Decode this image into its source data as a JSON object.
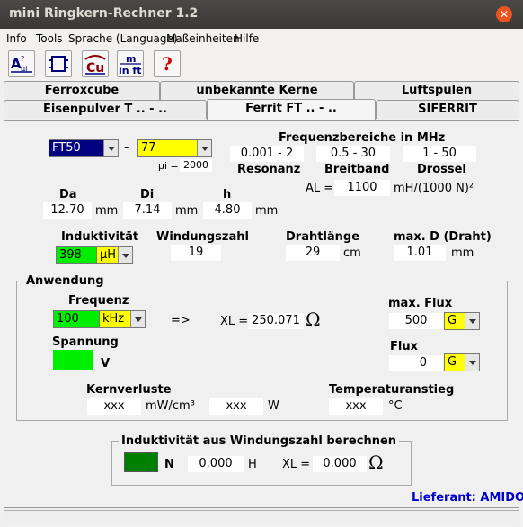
{
  "window": {
    "title": "mini Ringkern-Rechner 1.2"
  },
  "menu": [
    "Info",
    "Tools",
    "Sprache (Language)",
    "Maßeinheiten",
    "Hilfe"
  ],
  "toolbar": [
    {
      "icon": "inductance-ring-icon",
      "text": "A",
      "sub": "L μi"
    },
    {
      "icon": "coil-icon",
      "text": ""
    },
    {
      "icon": "copper-icon",
      "text": "Cu"
    },
    {
      "icon": "units-icon",
      "text": "m",
      "sub": "in ft"
    },
    {
      "icon": "help-icon",
      "text": "?"
    }
  ],
  "tabs_row1": [
    "Ferroxcube",
    "unbekannte Kerne",
    "Luftspulen"
  ],
  "tabs_row2": [
    "Eisenpulver T .. - ..",
    "Ferrit FT .. - ..",
    "SIFERRIT"
  ],
  "core": {
    "type": "FT50",
    "material": "77",
    "mui_label": "μi =",
    "mui": "2000"
  },
  "freq": {
    "title": "Frequenzbereiche in MHz",
    "resonanz": "0.001 - 2",
    "breitband": "0.5 - 30",
    "drossel": "1 - 50",
    "resonanz_label": "Resonanz",
    "breitband_label": "Breitband",
    "drossel_label": "Drossel",
    "al_label": "AL =",
    "al_value": "1100",
    "al_unit": "mH/(1000 N)²"
  },
  "dims": {
    "da_label": "Da",
    "da": "12.70",
    "di_label": "Di",
    "di": "7.14",
    "h_label": "h",
    "h": "4.80",
    "unit": "mm"
  },
  "calc": {
    "ind_label": "Induktivität",
    "ind_value": "398",
    "ind_unit": "μH",
    "turns_label": "Windungszahl",
    "turns": "19",
    "wire_label": "Drahtlänge",
    "wire": "29",
    "wire_unit": "cm",
    "maxd_label": "max. D (Draht)",
    "maxd": "1.01",
    "maxd_unit": "mm"
  },
  "anwendung": {
    "legend": "Anwendung",
    "freq_label": "Frequenz",
    "freq_value": "100",
    "freq_unit": "kHz",
    "arrow": "=>",
    "xl_label": "XL =",
    "xl_value": "250.071",
    "ohm": "Ω",
    "maxflux_label": "max. Flux",
    "maxflux_value": "500",
    "maxflux_unit": "G",
    "spannung_label": "Spannung",
    "spannung_value": "",
    "v_unit": "V",
    "flux_label": "Flux",
    "flux_value": "0",
    "flux_unit": "G",
    "kernverluste_label": "Kernverluste",
    "kv_value": "xxx",
    "kv_unit": "mW/cm³",
    "w_value": "xxx",
    "w_unit": "W",
    "temp_label": "Temperaturanstieg",
    "temp_value": "xxx",
    "temp_unit": "°C"
  },
  "windung": {
    "legend": "Induktivität aus Windungszahl berechnen",
    "n_value": "",
    "n_label": "N",
    "h_value": "0.000",
    "h_label": "H",
    "xl_label": "XL =",
    "xl_value": "0.000",
    "ohm": "Ω"
  },
  "supplier": "Lieferant: AMIDON",
  "colors": {
    "accent_yellow": "#ffff00",
    "accent_green": "#00ee00",
    "dark_green": "#008000",
    "navy": "#000080",
    "supplier_blue": "#0000cc"
  }
}
